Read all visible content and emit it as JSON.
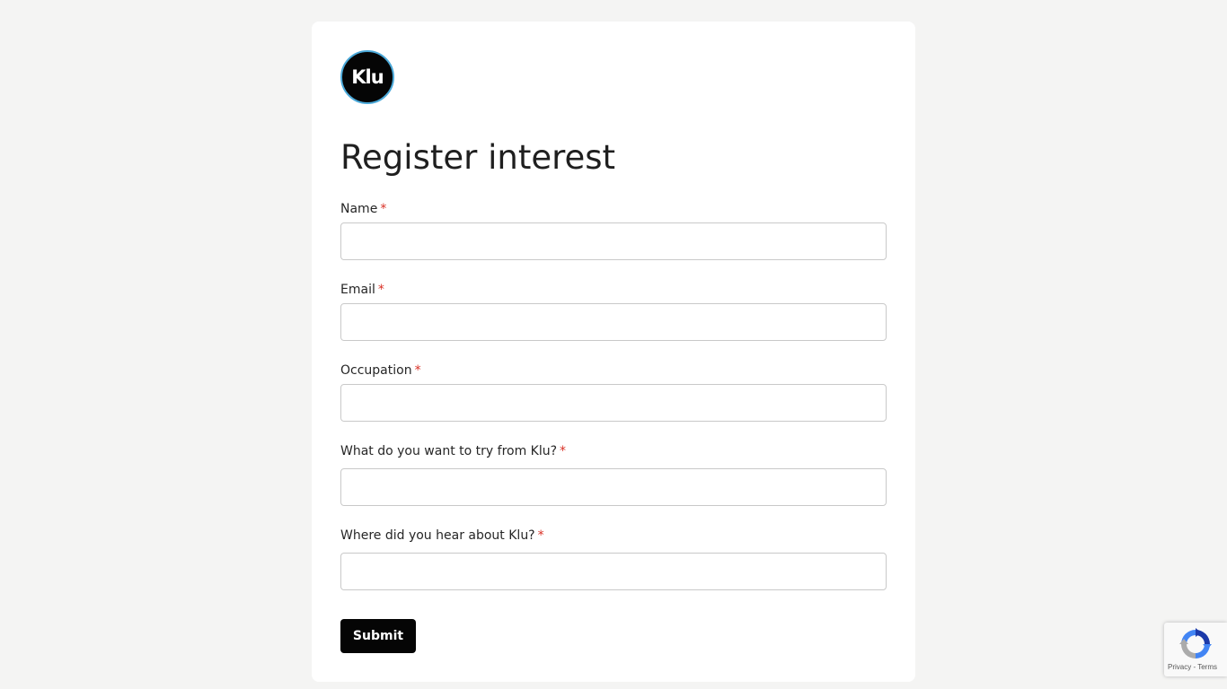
{
  "brand": {
    "logo_text": "Klu"
  },
  "form": {
    "title": "Register interest",
    "required_marker": "*",
    "fields": [
      {
        "label": "Name",
        "value": "",
        "placeholder": ""
      },
      {
        "label": "Email",
        "value": "",
        "placeholder": ""
      },
      {
        "label": "Occupation",
        "value": "",
        "placeholder": ""
      },
      {
        "label": "What do you want to try from Klu?",
        "value": "",
        "placeholder": ""
      },
      {
        "label": "Where did you hear about Klu?",
        "value": "",
        "placeholder": ""
      }
    ],
    "submit_label": "Submit"
  },
  "recaptcha": {
    "privacy_label": "Privacy",
    "separator": " - ",
    "terms_label": "Terms"
  },
  "colors": {
    "page_background": "#f4f4f3",
    "card_background": "#ffffff",
    "button_background": "#050505",
    "required_marker": "#d93025",
    "logo_ring": "#4aa8d8"
  }
}
